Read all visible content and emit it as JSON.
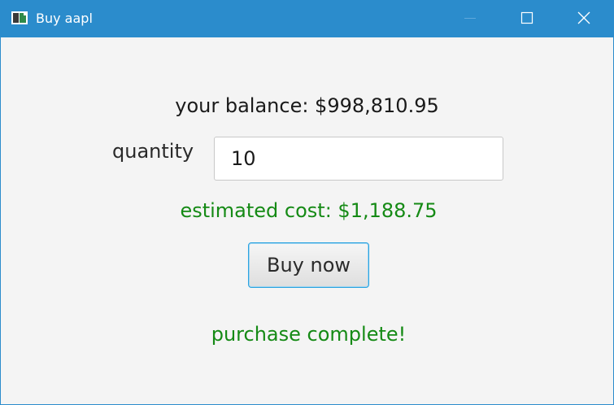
{
  "window": {
    "title": "Buy aapl",
    "title_bar_color": "#2b8ccc",
    "icons": {
      "app": "app-window-icon",
      "minimize": "minimize-icon",
      "maximize": "maximize-icon",
      "close": "close-icon"
    }
  },
  "form": {
    "balance_text": "your balance: $998,810.95",
    "quantity_label": "quantity",
    "quantity_value": "10",
    "estimated_cost_text": "estimated cost: $1,188.75",
    "buy_button_label": "Buy now",
    "status_text": "purchase complete!",
    "status_color": "#158a15"
  }
}
